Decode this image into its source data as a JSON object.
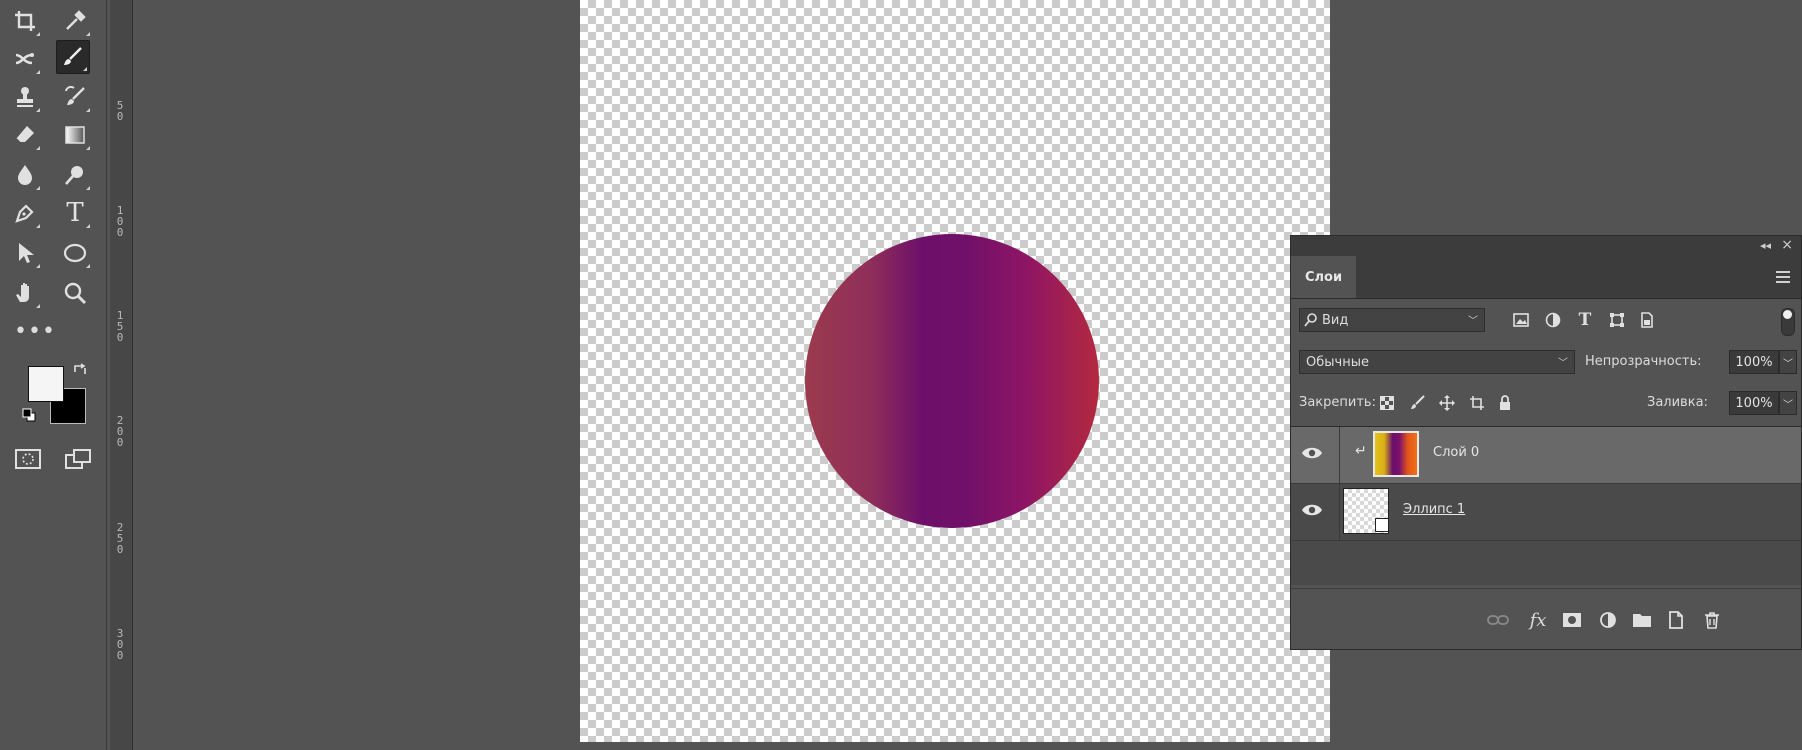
{
  "toolbar": {
    "tools": [
      {
        "name": "crop-tool",
        "icon": "crop-icon"
      },
      {
        "name": "eyedropper-tool",
        "icon": "eyedropper-icon"
      },
      {
        "name": "healing-tool",
        "icon": "healing-icon"
      },
      {
        "name": "brush-tool",
        "icon": "brush-icon",
        "active": true
      },
      {
        "name": "stamp-tool",
        "icon": "stamp-icon"
      },
      {
        "name": "history-brush-tool",
        "icon": "history-brush-icon"
      },
      {
        "name": "eraser-tool",
        "icon": "eraser-icon"
      },
      {
        "name": "gradient-tool",
        "icon": "gradient-icon"
      },
      {
        "name": "blur-tool",
        "icon": "blur-icon"
      },
      {
        "name": "dodge-tool",
        "icon": "dodge-icon"
      },
      {
        "name": "pen-tool",
        "icon": "pen-icon"
      },
      {
        "name": "type-tool",
        "icon": "type-icon",
        "glyph": "T"
      },
      {
        "name": "path-selection-tool",
        "icon": "arrow-icon"
      },
      {
        "name": "ellipse-tool",
        "icon": "ellipse-icon"
      },
      {
        "name": "hand-tool",
        "icon": "hand-icon"
      },
      {
        "name": "zoom-tool",
        "icon": "zoom-icon"
      }
    ],
    "more_tools": "•••",
    "foreground_color": "#f5f5f5",
    "background_color": "#000000"
  },
  "ruler": {
    "labels": [
      "5 0",
      "1 0 0",
      "1 5 0",
      "2 0 0",
      "2 5 0",
      "3 0 0"
    ]
  },
  "canvas": {
    "shape": "ellipse",
    "gradient_colors": [
      "#9c3a4e",
      "#6d0f6a",
      "#8e1565",
      "#b3293f"
    ]
  },
  "layers_panel": {
    "tab_label": "Слои",
    "filter_placeholder": "Вид",
    "blend_mode": "Обычные",
    "opacity_label": "Непрозрачность:",
    "opacity_value": "100%",
    "lock_label": "Закрепить:",
    "fill_label": "Заливка:",
    "fill_value": "100%",
    "layers": [
      {
        "name": "Слой 0",
        "visible": true,
        "selected": true,
        "clipped": true,
        "clip_glyph": "↵"
      },
      {
        "name": "Эллипс 1",
        "visible": true,
        "selected": false
      }
    ],
    "footer_icons": [
      "link-icon",
      "fx-icon",
      "mask-icon",
      "adjustment-icon",
      "folder-icon",
      "new-layer-icon",
      "trash-icon"
    ],
    "fx_label": "fx"
  }
}
